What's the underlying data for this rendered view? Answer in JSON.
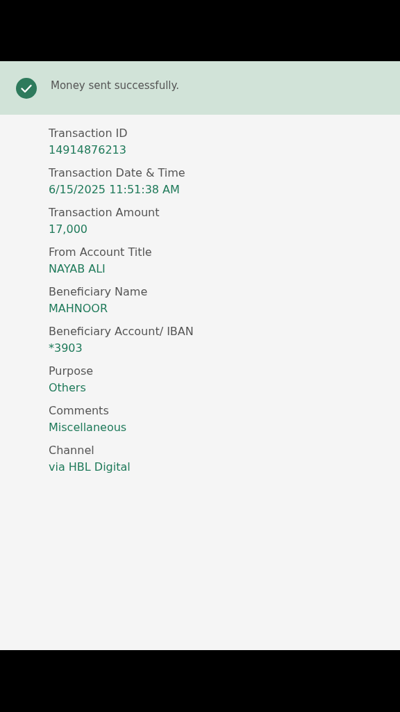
{
  "banner": {
    "message": "Money sent successfully."
  },
  "details": [
    {
      "label": "Transaction ID",
      "value": "14914876213"
    },
    {
      "label": "Transaction Date & Time",
      "value": "6/15/2025 11:51:38 AM"
    },
    {
      "label": "Transaction Amount",
      "value": "17,000"
    },
    {
      "label": "From Account Title",
      "value": "NAYAB ALI"
    },
    {
      "label": "Beneficiary Name",
      "value": "MAHNOOR"
    },
    {
      "label": "Beneficiary Account/ IBAN",
      "value": "*3903"
    },
    {
      "label": "Purpose",
      "value": "Others"
    },
    {
      "label": "Comments",
      "value": "Miscellaneous"
    },
    {
      "label": "Channel",
      "value": "via HBL Digital"
    }
  ]
}
